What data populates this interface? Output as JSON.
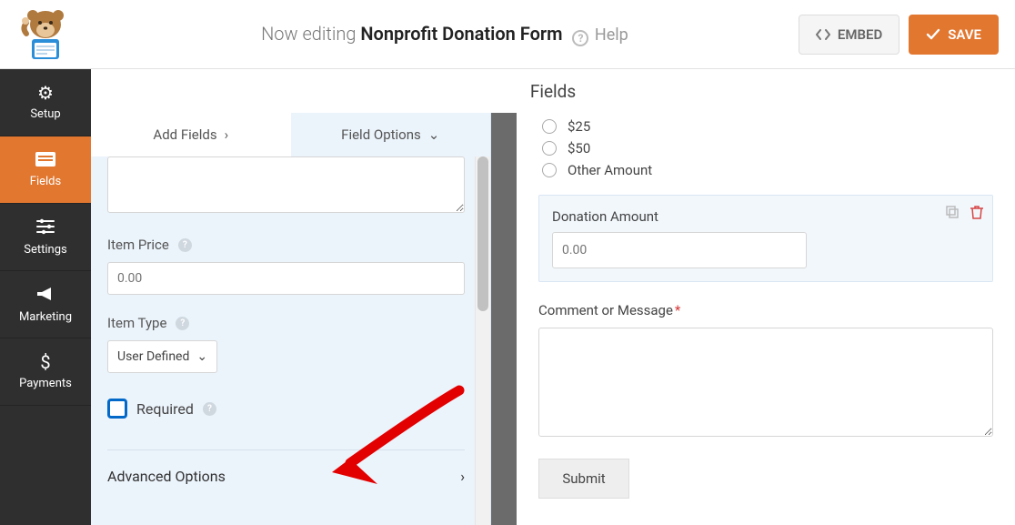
{
  "header": {
    "editing_prefix": "Now editing",
    "form_name": "Nonprofit Donation Form",
    "help_label": "Help",
    "embed_label": "EMBED",
    "save_label": "SAVE"
  },
  "sidebar": {
    "items": [
      {
        "label": "Setup"
      },
      {
        "label": "Fields"
      },
      {
        "label": "Settings"
      },
      {
        "label": "Marketing"
      },
      {
        "label": "Payments"
      }
    ]
  },
  "section_title": "Fields",
  "tabs": {
    "add_fields": "Add Fields",
    "field_options": "Field Options"
  },
  "panel": {
    "item_price_label": "Item Price",
    "item_price_value": "0.00",
    "item_type_label": "Item Type",
    "item_type_value": "User Defined",
    "required_label": "Required",
    "advanced_label": "Advanced Options"
  },
  "preview": {
    "radio_options": [
      "$25",
      "$50",
      "Other Amount"
    ],
    "donation_label": "Donation Amount",
    "donation_value": "0.00",
    "comment_label": "Comment or Message",
    "submit_label": "Submit"
  },
  "colors": {
    "accent": "#e27730",
    "focus": "#0369c9"
  }
}
